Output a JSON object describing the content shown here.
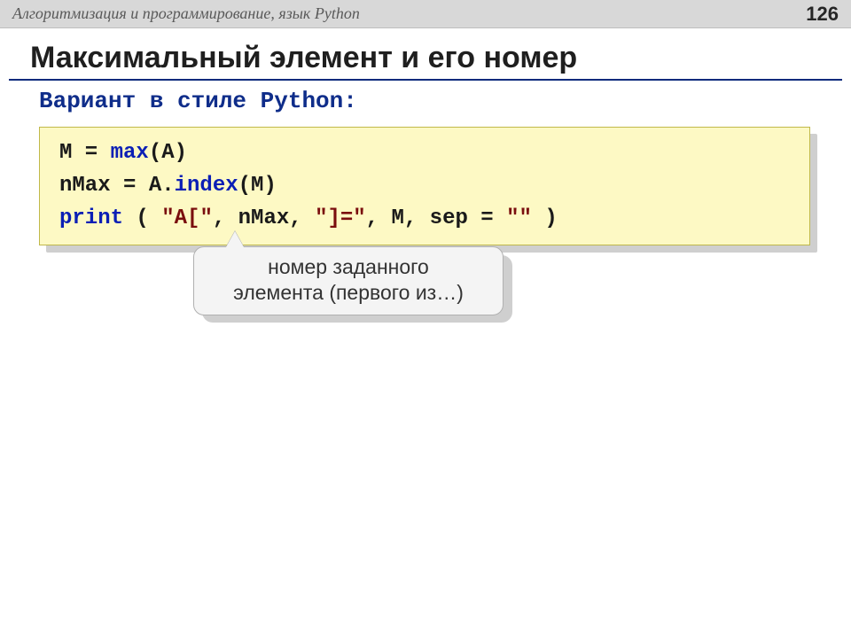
{
  "header": {
    "course_title": "Алгоритмизация и программирование, язык Python",
    "page_number": "126"
  },
  "title": "Максимальный элемент и его номер",
  "subtitle": "Вариант в стиле Python:",
  "code": {
    "line1": {
      "pre": "M = ",
      "fn": "max",
      "post": "(A)"
    },
    "line2": {
      "pre": "nMax = A.",
      "fn": "index",
      "post": "(M)"
    },
    "line3": {
      "kw": "print",
      "space_after_kw": " ",
      "open": "( ",
      "s1": "\"A[\"",
      "sep1": ", nMax, ",
      "s2": "\"]=\"",
      "sep2": ", M, sep = ",
      "s3": "\"\"",
      "close": " )"
    }
  },
  "callout": {
    "line1": "номер заданного",
    "line2": "элемента (первого из…)"
  }
}
